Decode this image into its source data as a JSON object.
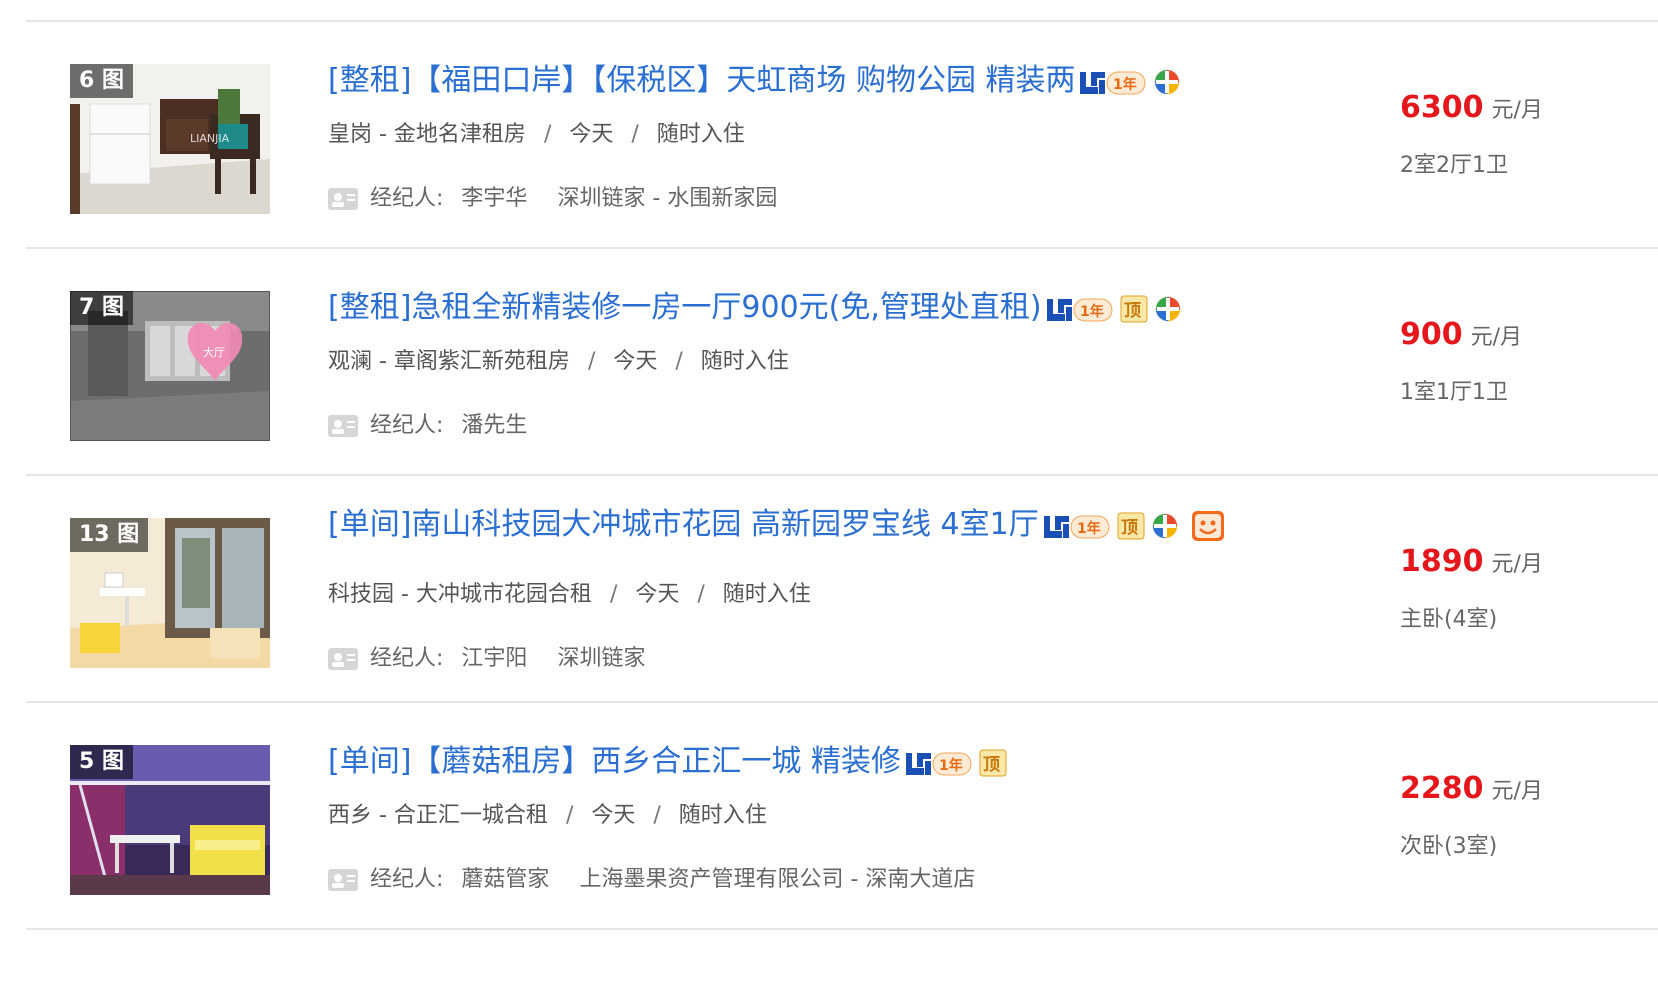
{
  "listings": [
    {
      "photo_count": "6 图",
      "title": "[整租]【福田口岸】【保税区】天虹商场 购物公园 精装两",
      "badges": [
        "lianjia-1year-icon",
        "shield-icon"
      ],
      "area": "皇岗 - 金地名津租房",
      "date": "今天",
      "move_in": "随时入住",
      "agent_label": "经纪人:",
      "agent_name": "李宇华",
      "agent_company": "深圳链家 - 水围新家园",
      "price": "6300",
      "price_unit": "元/月",
      "layout": "2室2厅1卫"
    },
    {
      "photo_count": "7 图",
      "title": "[整租]急租全新精装修一房一厅900元(免,管理处直租)",
      "badges": [
        "lianjia-1year-icon",
        "top-icon",
        "shield-icon"
      ],
      "area": "观澜 -  章阁紫汇新苑租房",
      "date": "今天",
      "move_in": "随时入住",
      "agent_label": "经纪人:",
      "agent_name": "潘先生",
      "agent_company": "",
      "price": "900",
      "price_unit": "元/月",
      "layout": "1室1厅1卫"
    },
    {
      "photo_count": "13 图",
      "title": "[单间]南山科技园大冲城市花园 高新园罗宝线 4室1厅",
      "badges": [
        "lianjia-1year-icon",
        "top-icon",
        "shield-icon",
        "smile-icon"
      ],
      "area": "科技园 - 大冲城市花园合租",
      "date": "今天",
      "move_in": "随时入住",
      "agent_label": "经纪人:",
      "agent_name": "江宇阳",
      "agent_company": "深圳链家",
      "price": "1890",
      "price_unit": "元/月",
      "layout": "主卧(4室)"
    },
    {
      "photo_count": "5 图",
      "title": "[单间]【蘑菇租房】西乡合正汇一城 精装修",
      "badges": [
        "lianjia-1year-icon",
        "top-icon"
      ],
      "area": "西乡 - 合正汇一城合租",
      "date": "今天",
      "move_in": "随时入住",
      "agent_label": "经纪人:",
      "agent_name": "蘑菇管家",
      "agent_company": "上海墨果资产管理有限公司 - 深南大道店",
      "price": "2280",
      "price_unit": "元/月",
      "layout": "次卧(3室)"
    }
  ],
  "thumb_labels": {
    "listing_1": "LIANJIA",
    "listing_2": "大厅"
  },
  "colors": {
    "title": "#2a6fd1",
    "price": "#e4171d",
    "meta": "#555555",
    "divider": "#e6e6e6"
  }
}
